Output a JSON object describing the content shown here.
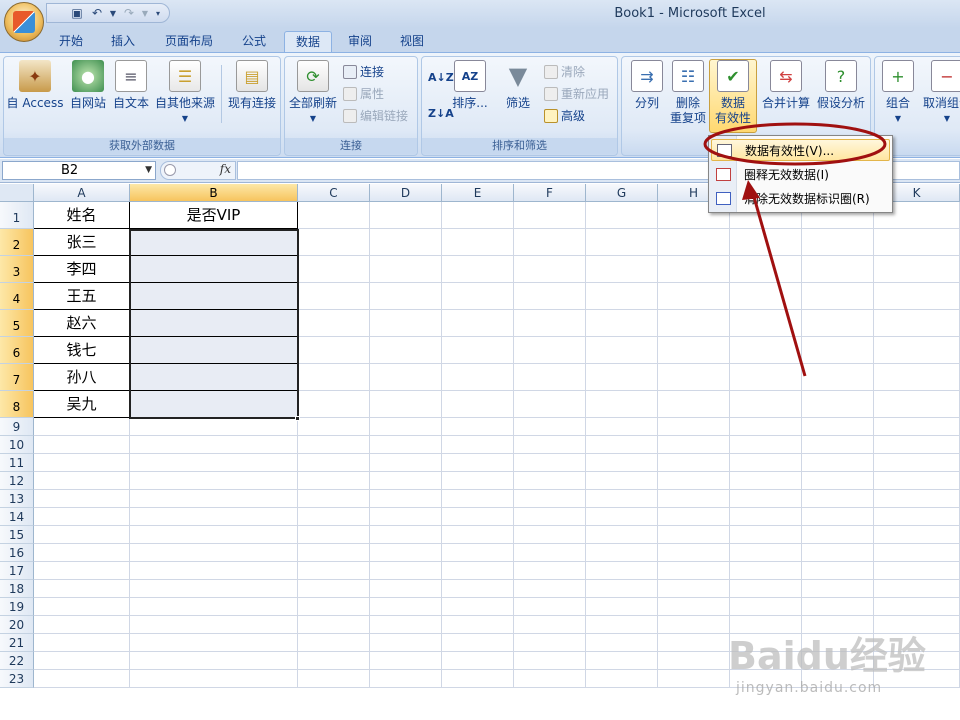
{
  "window": {
    "title": "Book1 - Microsoft Excel"
  },
  "tabs": [
    "开始",
    "插入",
    "页面布局",
    "公式",
    "数据",
    "审阅",
    "视图"
  ],
  "ribbon": {
    "get_external": {
      "label": "获取外部数据",
      "from_access": "自 Access",
      "from_web": "自网站",
      "from_text": "自文本",
      "from_other": "自其他来源",
      "existing": "现有连接"
    },
    "connections": {
      "label": "连接",
      "refresh_all": "全部刷新",
      "connections": "连接",
      "properties": "属性",
      "edit_links": "编辑链接"
    },
    "sort_filter": {
      "label": "排序和筛选",
      "sort": "排序...",
      "filter": "筛选",
      "clear": "清除",
      "reapply": "重新应用",
      "advanced": "高级"
    },
    "data_tools": {
      "text_to_columns": "分列",
      "remove_dup_1": "删除",
      "remove_dup_2": "重复项",
      "validation_1": "数据",
      "validation_2": "有效性",
      "consolidate": "合并计算",
      "whatif": "假设分析"
    },
    "outline": {
      "group": "组合",
      "ungroup": "取消组合"
    }
  },
  "formula_bar": {
    "name_box": "B2",
    "fx": "fx",
    "content": ""
  },
  "columns": [
    "A",
    "B",
    "C",
    "D",
    "E",
    "F",
    "G",
    "H",
    "I",
    "J",
    "K"
  ],
  "rows": [
    "1",
    "2",
    "3",
    "4",
    "5",
    "6",
    "7",
    "8",
    "9",
    "10",
    "11",
    "12",
    "13",
    "14",
    "15",
    "16",
    "17",
    "18",
    "19",
    "20",
    "21",
    "22",
    "23"
  ],
  "cells": {
    "A1": "姓名",
    "B1": "是否VIP",
    "A2": "张三",
    "A3": "李四",
    "A4": "王五",
    "A5": "赵六",
    "A6": "钱七",
    "A7": "孙八",
    "A8": "吴九"
  },
  "dropdown": {
    "items": [
      "数据有效性(V)...",
      "圈释无效数据(I)",
      "清除无效数据标识圈(R)"
    ]
  },
  "watermark": {
    "main": "Baidu经验",
    "sub": "jingyan.baidu.com"
  },
  "colors": {
    "annotation": "#a01010",
    "ribbon": "#dbe7f5",
    "selection": "#f7c45e"
  }
}
